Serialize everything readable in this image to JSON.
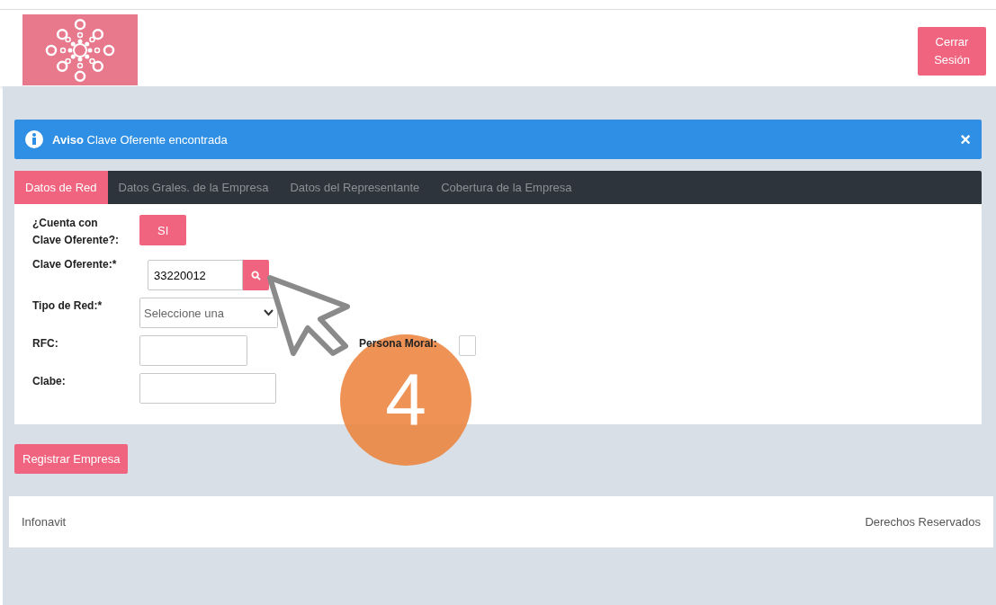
{
  "header": {
    "logout_button": "Cerrar Sesión"
  },
  "alert": {
    "title": "Aviso",
    "message": "Clave Oferente encontrada",
    "close": "×"
  },
  "tabs": [
    {
      "label": "Datos de Red",
      "selected": true
    },
    {
      "label": "Datos Grales. de la Empresa",
      "selected": false
    },
    {
      "label": "Datos del Representante",
      "selected": false
    },
    {
      "label": "Cobertura de la Empresa",
      "selected": false
    }
  ],
  "form": [
    {
      "kind": "toggle",
      "label": "¿Cuenta con Clave Oferente?:",
      "value": "SI"
    },
    {
      "kind": "search",
      "label": "Clave Oferente:*",
      "value": "33220012"
    },
    {
      "kind": "select",
      "label": "Tipo de Red:*",
      "value": "Seleccione una"
    },
    {
      "kind": "text",
      "label": "RFC:",
      "extra": {
        "label": "Persona Moral:",
        "checked": false
      }
    },
    {
      "kind": "text",
      "label": "Clabe:",
      "wide": true
    }
  ],
  "submit_button": "Registrar Empresa",
  "annotation": {
    "step": "4"
  },
  "footer": {
    "left": "Infonavit",
    "right": "Derechos Reservados"
  }
}
